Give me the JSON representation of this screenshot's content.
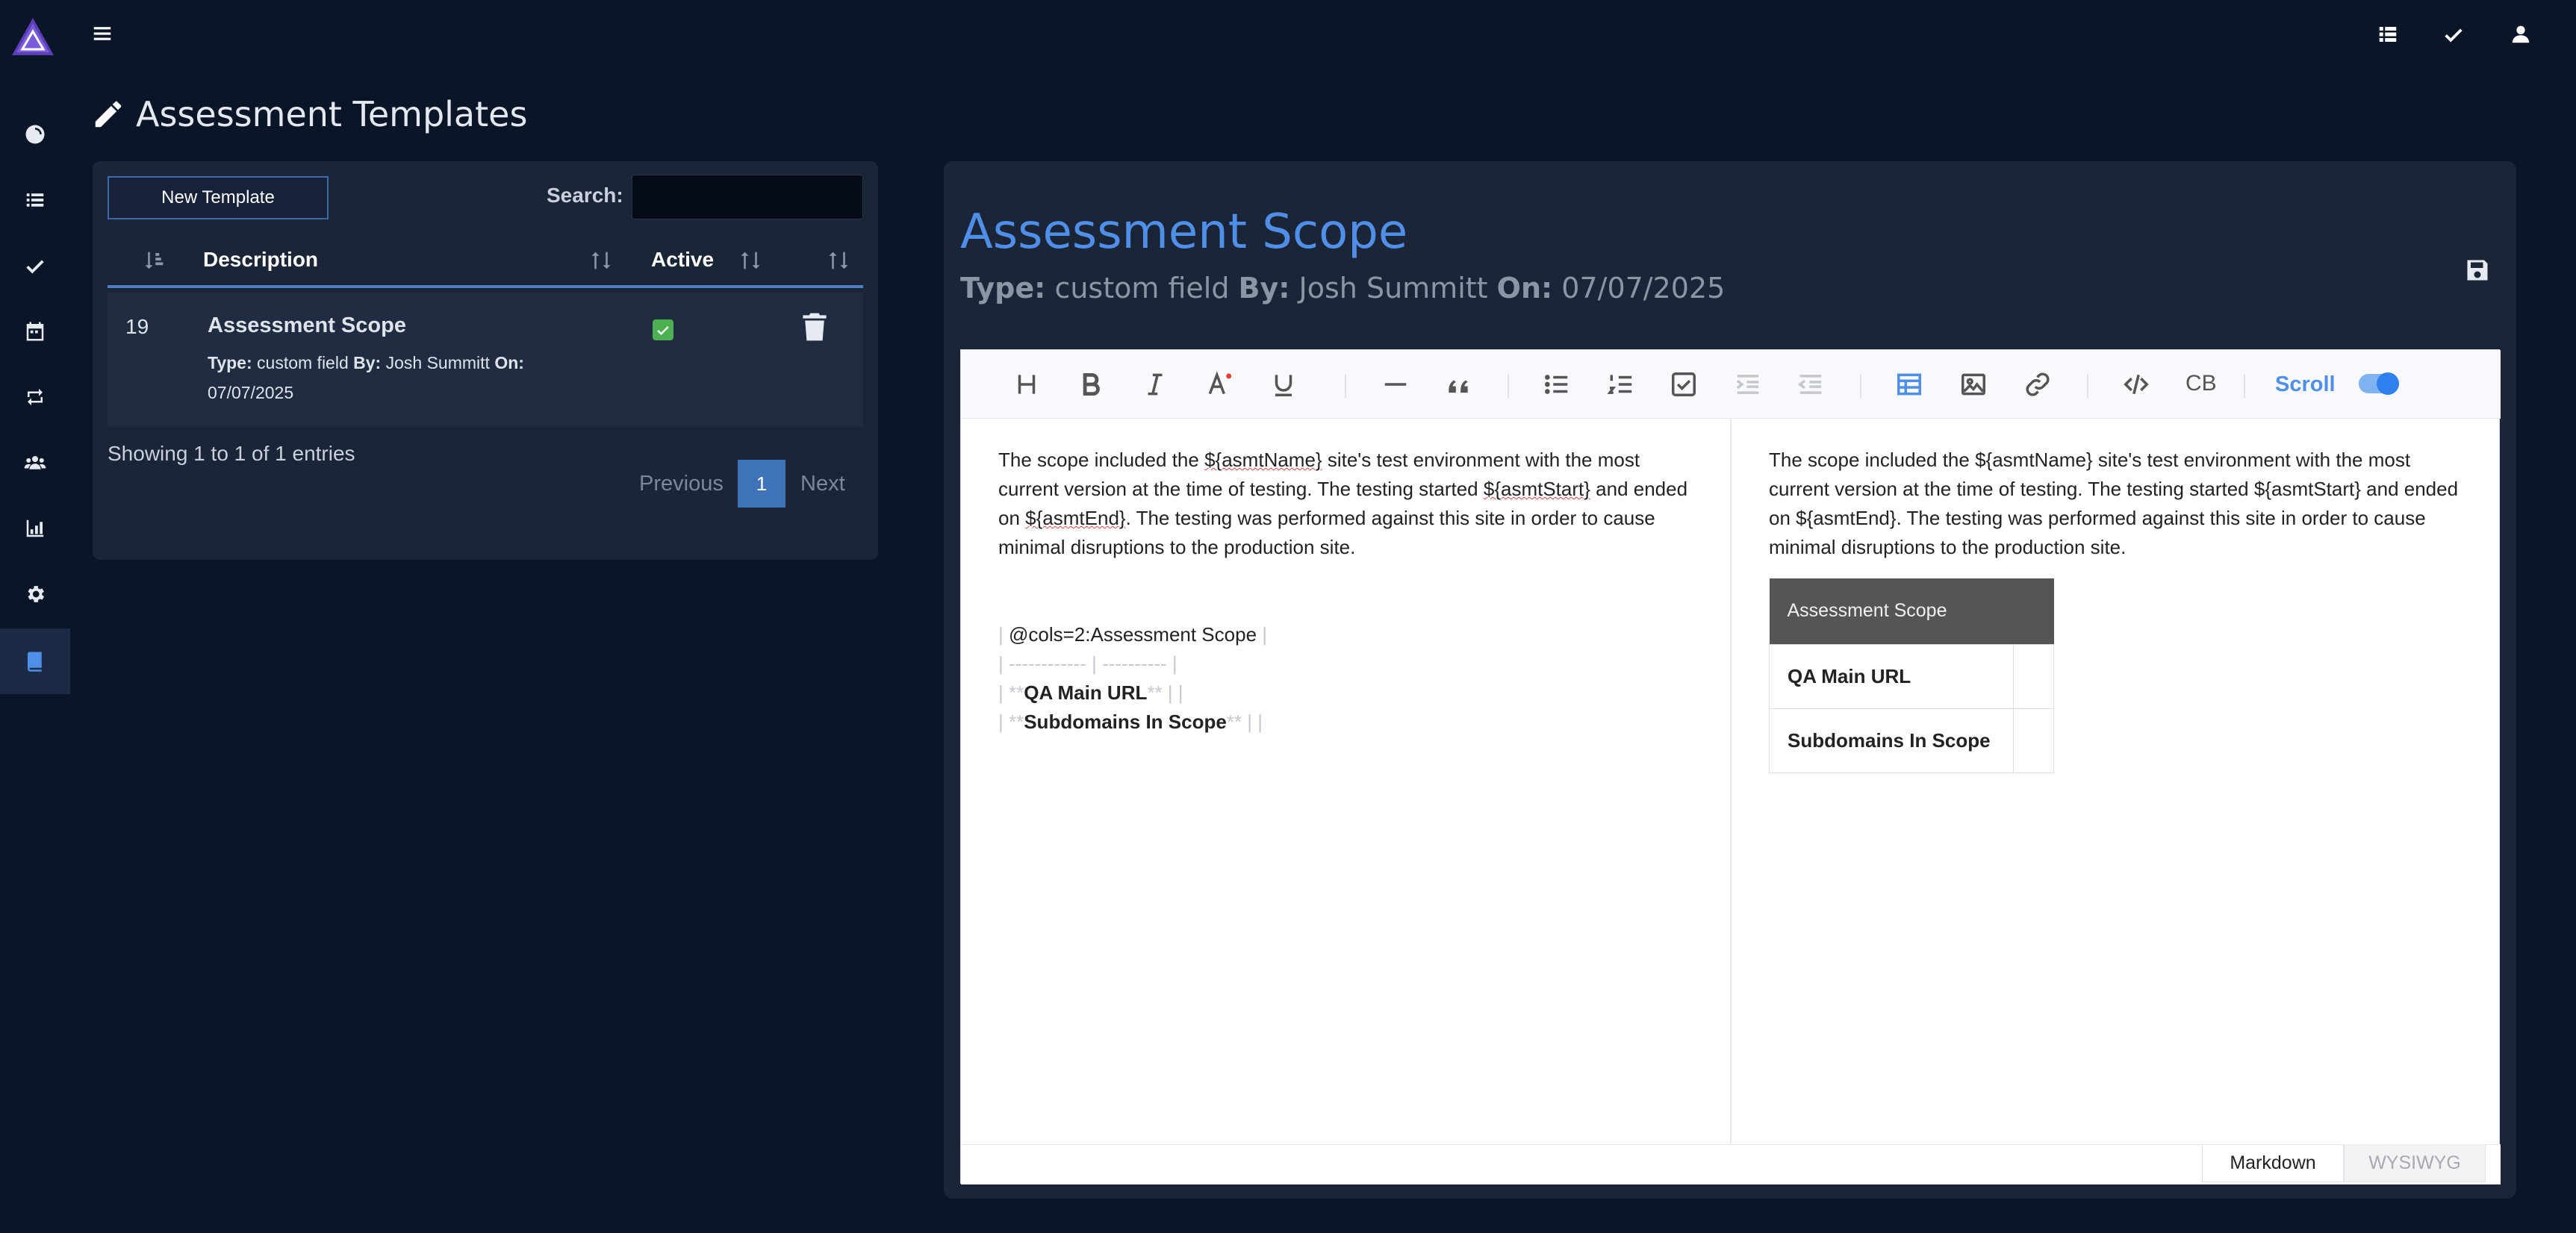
{
  "sidebar": {
    "items": [
      {
        "name": "dashboard"
      },
      {
        "name": "list"
      },
      {
        "name": "check"
      },
      {
        "name": "calendar"
      },
      {
        "name": "retweet"
      },
      {
        "name": "users"
      },
      {
        "name": "chart"
      },
      {
        "name": "settings"
      },
      {
        "name": "book",
        "active": true
      }
    ]
  },
  "page": {
    "title": "Assessment Templates"
  },
  "templates_table": {
    "new_button": "New Template",
    "search_label": "Search:",
    "search_value": "",
    "headers": {
      "description": "Description",
      "active": "Active"
    },
    "rows": [
      {
        "id": "19",
        "title": "Assessment Scope",
        "type_label": "Type:",
        "type_value": " custom field ",
        "by_label": "By:",
        "by_value": " Josh Summitt ",
        "on_label": "On:",
        "on_value": "07/07/2025",
        "active": true
      }
    ],
    "showing": "Showing 1 to 1 of 1 entries",
    "pager": {
      "previous": "Previous",
      "page": "1",
      "next": "Next"
    }
  },
  "detail": {
    "title": "Assessment Scope",
    "type_label": "Type:",
    "type_value": " custom field ",
    "by_label": "By:",
    "by_value": " Josh Summitt ",
    "on_label": "On:",
    "on_value": " 07/07/2025"
  },
  "editor": {
    "toolbar": {
      "code_block_label": "CB",
      "scroll_label": "Scroll",
      "scroll_on": true
    },
    "markdown": {
      "p_part1": "The scope included the ",
      "var1": "${asmtName}",
      "p_part2": "  site's test environment with the most current version at the time of testing. The testing started ",
      "var2": "${asmtStart}",
      "p_part3": " and ended on ",
      "var3": "${asmtEnd}",
      "p_part4": ". The testing was performed against this site in order to cause minimal disruptions to the production site.",
      "line1": "@cols=2:Assessment Scope",
      "line2": "------------ | ----------",
      "line3_bold": "QA Main URL",
      "line4_bold": "Subdomains In Scope"
    },
    "preview": {
      "paragraph": "The scope included the ${asmtName}  site's test environment with the most current version at the time of testing. The testing started ${asmtStart} and ended on ${asmtEnd}. The testing was performed against this site in order to cause minimal disruptions to the production site.",
      "table_header": "Assessment Scope",
      "row1": "QA Main URL",
      "row2": "Subdomains In Scope"
    },
    "modes": {
      "markdown": "Markdown",
      "wysiwyg": "WYSIWYG"
    }
  }
}
